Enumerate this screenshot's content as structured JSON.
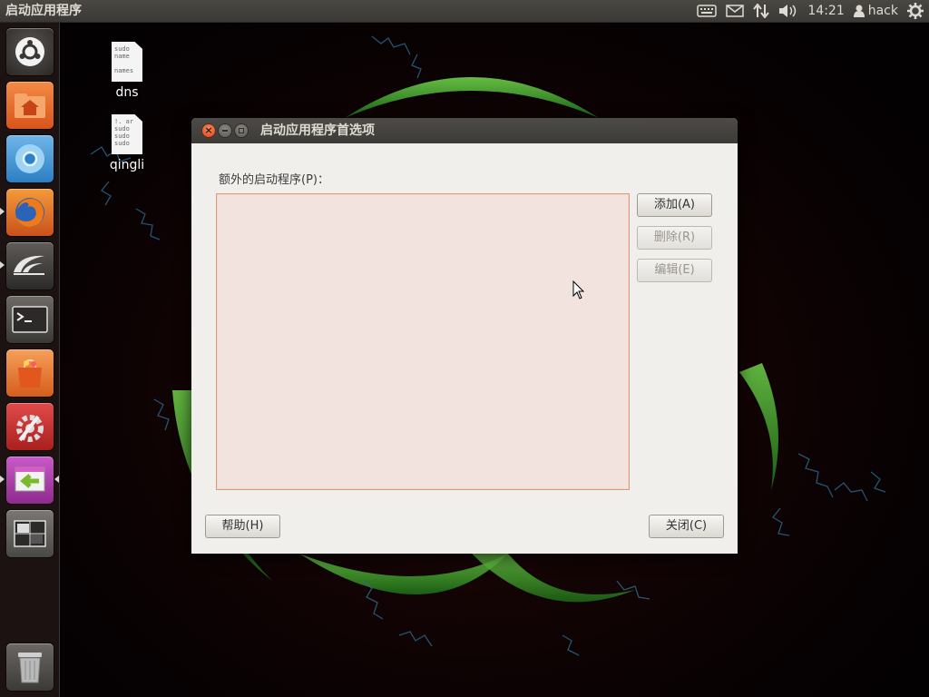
{
  "top_panel": {
    "app_title": "启动应用程序",
    "time": "14:21",
    "user": "hack",
    "icons": [
      "keyboard-icon",
      "mail-icon",
      "network-icon",
      "volume-icon",
      "user-icon",
      "gear-icon"
    ]
  },
  "launcher": {
    "items": [
      "ubuntu-dash",
      "home-folder",
      "chromium",
      "firefox",
      "eclipse",
      "terminal",
      "software-center",
      "system-settings",
      "startup-applications",
      "workspace-switcher",
      "trash"
    ]
  },
  "desktop": {
    "icons": [
      {
        "label": "dns",
        "thumb_text": [
          "sudo",
          "name",
          "",
          "names"
        ]
      },
      {
        "label": "qingli",
        "thumb_text": [
          "!. ar",
          "sudo",
          "sudo",
          "sudo"
        ]
      }
    ]
  },
  "dialog": {
    "title": "启动应用程序首选项",
    "list_label": "额外的启动程序(P)：",
    "buttons": {
      "add": "添加(A)",
      "delete": "删除(R)",
      "edit": "编辑(E)",
      "help": "帮助(H)",
      "close": "关闭(C)"
    }
  },
  "colors": {
    "panel": "#3c3b37",
    "dialog_bg": "#f1efec",
    "list_bg": "#f3e3df",
    "list_border": "#d99a80",
    "close_button": "#e2522a"
  }
}
